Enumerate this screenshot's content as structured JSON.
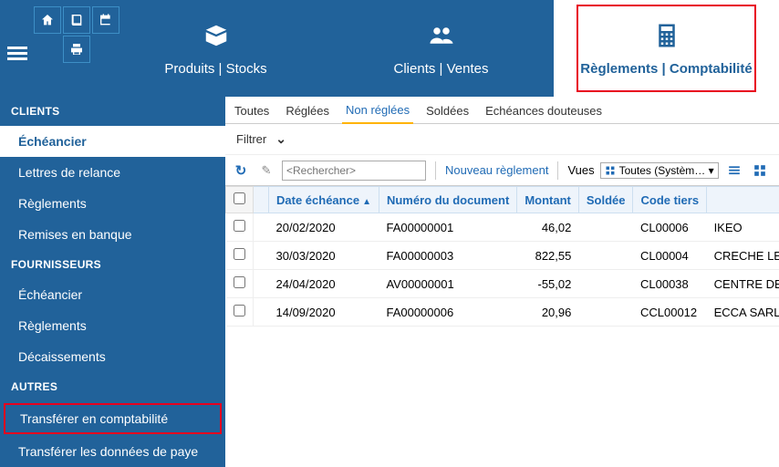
{
  "nav": {
    "produits": "Produits | Stocks",
    "clients": "Clients | Ventes",
    "reglements": "Règlements | Comptabilité"
  },
  "sidebar": {
    "groups": [
      {
        "title": "CLIENTS",
        "items": [
          "Échéancier",
          "Lettres de relance",
          "Règlements",
          "Remises en banque"
        ],
        "activeIndex": 0
      },
      {
        "title": "FOURNISSEURS",
        "items": [
          "Échéancier",
          "Règlements",
          "Décaissements"
        ],
        "activeIndex": -1
      },
      {
        "title": "AUTRES",
        "items": [
          "Transférer en comptabilité",
          "Transférer les données de paye"
        ],
        "activeIndex": -1,
        "highlightIndex": 0
      }
    ]
  },
  "statusTabs": [
    "Toutes",
    "Réglées",
    "Non réglées",
    "Soldées",
    "Echéances douteuses"
  ],
  "statusActive": 2,
  "filterLabel": "Filtrer",
  "toolbar": {
    "searchPlaceholder": "<Rechercher>",
    "newPayment": "Nouveau règlement",
    "viewsLabel": "Vues",
    "viewsValue": "Toutes (Systèm… ▾"
  },
  "columns": [
    "",
    "Date échéance",
    "Numéro du document",
    "Montant",
    "Soldée",
    "Code tiers",
    ""
  ],
  "rows": [
    {
      "date": "20/02/2020",
      "doc": "FA00000001",
      "amount": "46,02",
      "sold": "",
      "code": "CL00006",
      "name": "IKEO"
    },
    {
      "date": "30/03/2020",
      "doc": "FA00000003",
      "amount": "822,55",
      "sold": "",
      "code": "CL00004",
      "name": "CRECHE LES"
    },
    {
      "date": "24/04/2020",
      "doc": "AV00000001",
      "amount": "-55,02",
      "sold": "",
      "code": "CL00038",
      "name": "CENTRE DE"
    },
    {
      "date": "14/09/2020",
      "doc": "FA00000006",
      "amount": "20,96",
      "sold": "",
      "code": "CCL00012",
      "name": "ECCA SARL"
    }
  ]
}
